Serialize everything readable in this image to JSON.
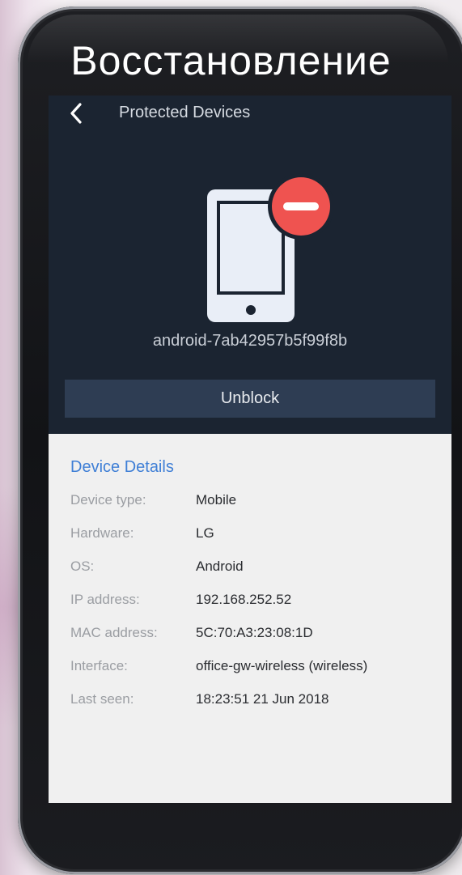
{
  "overlay": {
    "title": "Восстановление"
  },
  "nav": {
    "title": "Protected Devices",
    "back_icon": "chevron-left-icon"
  },
  "device": {
    "name": "android-7ab42957b5f99f8b",
    "icon": "blocked-phone-icon",
    "badge_color": "#ef5350"
  },
  "actions": {
    "unblock_label": "Unblock"
  },
  "details": {
    "title": "Device Details",
    "rows": [
      {
        "label": "Device type:",
        "value": "Mobile"
      },
      {
        "label": "Hardware:",
        "value": "LG"
      },
      {
        "label": "OS:",
        "value": "Android"
      },
      {
        "label": "IP address:",
        "value": "192.168.252.52"
      },
      {
        "label": "MAC address:",
        "value": "5C:70:A3:23:08:1D"
      },
      {
        "label": "Interface:",
        "value": "office-gw-wireless (wireless)"
      },
      {
        "label": "Last seen:",
        "value": "18:23:51 21 Jun 2018"
      }
    ]
  },
  "colors": {
    "header_bg": "#1b2431",
    "button_bg": "#2e3d53",
    "accent": "#3f7fd6",
    "content_bg": "#f0f0f0"
  }
}
